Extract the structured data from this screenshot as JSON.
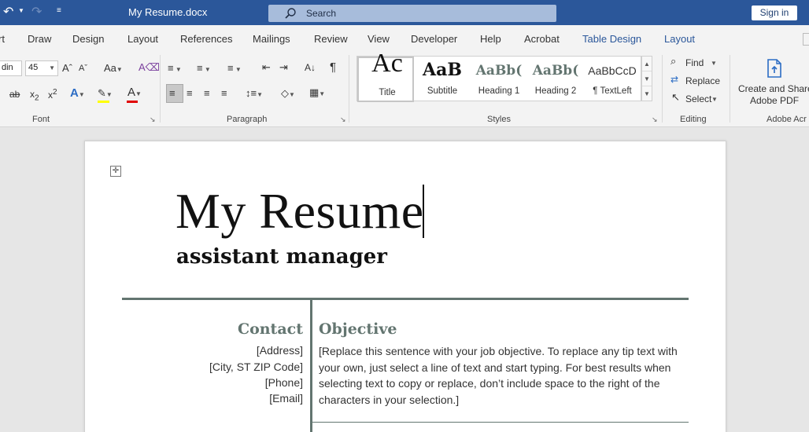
{
  "titlebar": {
    "doc_title": "My Resume.docx",
    "search_placeholder": "Search",
    "signin_label": "Sign in"
  },
  "tabs": [
    {
      "label": "rt"
    },
    {
      "label": "Draw"
    },
    {
      "label": "Design"
    },
    {
      "label": "Layout"
    },
    {
      "label": "References"
    },
    {
      "label": "Mailings"
    },
    {
      "label": "Review"
    },
    {
      "label": "View"
    },
    {
      "label": "Developer"
    },
    {
      "label": "Help"
    },
    {
      "label": "Acrobat"
    },
    {
      "label": "Table Design"
    },
    {
      "label": "Layout"
    }
  ],
  "ribbon": {
    "font": {
      "font_name": "din",
      "font_size": "45",
      "group_label": "Font"
    },
    "paragraph": {
      "group_label": "Paragraph"
    },
    "styles": {
      "group_label": "Styles",
      "items": [
        {
          "preview": "Ac",
          "name": "Title"
        },
        {
          "preview": "AaB",
          "name": "Subtitle"
        },
        {
          "preview": "AaBb(",
          "name": "Heading 1"
        },
        {
          "preview": "AaBb(",
          "name": "Heading 2"
        },
        {
          "preview": "AaBbCcD",
          "name": "¶ TextLeft"
        }
      ]
    },
    "editing": {
      "group_label": "Editing",
      "find_label": "Find",
      "replace_label": "Replace",
      "select_label": "Select"
    },
    "acrobat": {
      "group_label": "Adobe Acr",
      "create_line1": "Create and Share",
      "create_line2": "Adobe PDF"
    }
  },
  "document": {
    "title": "My Resume",
    "subtitle": "assistant manager",
    "contact": {
      "heading": "Contact",
      "lines": [
        "[Address]",
        "[City, ST ZIP Code]",
        "[Phone]",
        "[Email]"
      ]
    },
    "objective": {
      "heading": "Objective",
      "text": "[Replace this sentence with your job objective. To replace any tip text with your own, just select a line of text and start typing. For best results when selecting text to copy or replace, don’t include space to the right of the characters in your selection.]"
    }
  },
  "colors": {
    "titlebar": "#2b579a",
    "accent_green": "#637570",
    "tab_blue": "#2b579a"
  }
}
